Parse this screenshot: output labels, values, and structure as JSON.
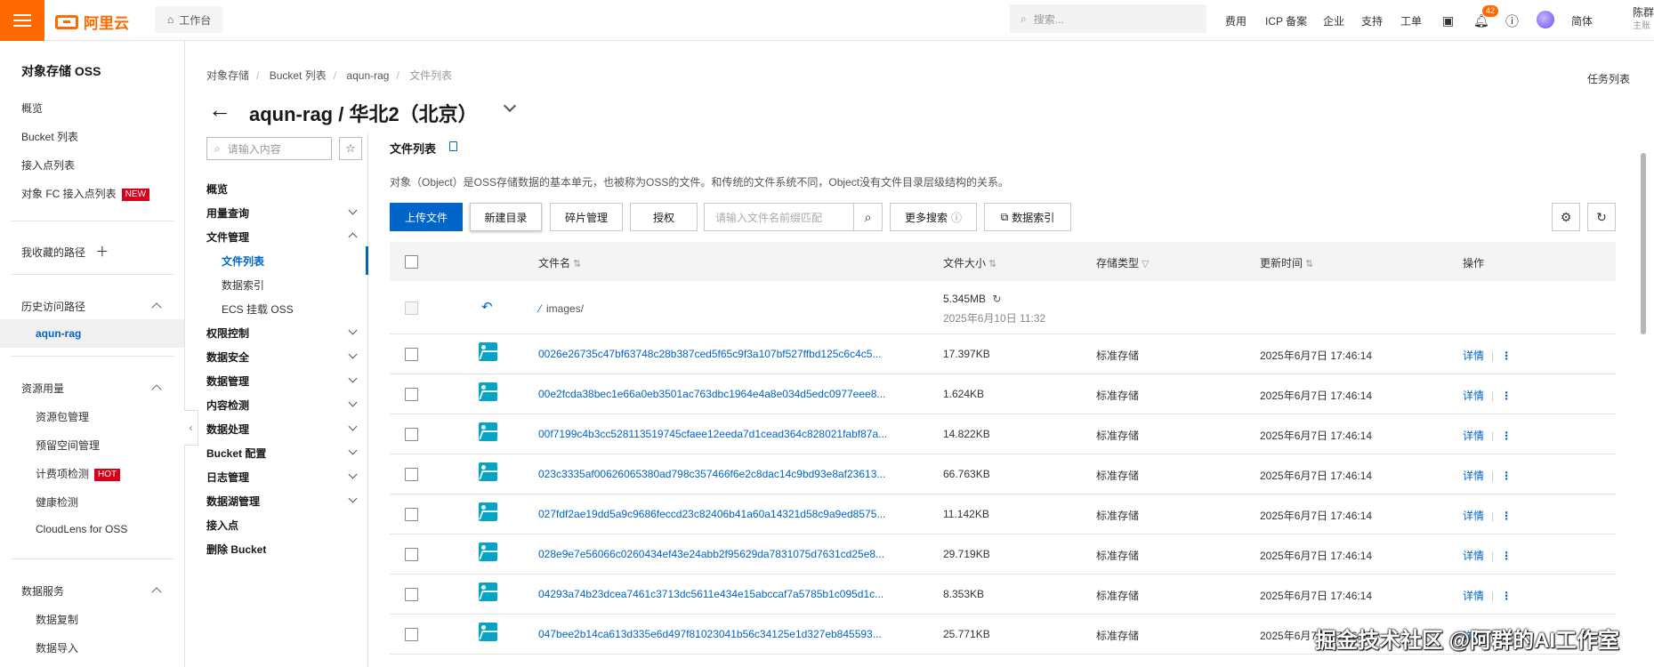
{
  "topbar": {
    "brand": "阿里云",
    "workbench": "工作台",
    "search_placeholder": "搜索...",
    "nav": [
      "费用",
      "ICP 备案",
      "企业",
      "支持",
      "工单"
    ],
    "bell_count": "42",
    "lang": "简体",
    "user_name": "陈群",
    "user_role": "主账"
  },
  "sidebar": {
    "title": "对象存储 OSS",
    "items": [
      "概览",
      "Bucket 列表",
      "接入点列表",
      "对象 FC 接入点列表"
    ],
    "new_badge": "NEW",
    "favorites": "我收藏的路径",
    "history": "历史访问路径",
    "history_active": "aqun-rag",
    "resources": "资源用量",
    "resource_items": [
      "资源包管理",
      "预留空间管理",
      "计费项检测",
      "健康检测",
      "CloudLens for OSS"
    ],
    "hot_badge": "HOT",
    "data_service": "数据服务",
    "data_items": [
      "数据复制",
      "数据导入"
    ]
  },
  "breadcrumb": [
    "对象存储",
    "Bucket 列表",
    "aqun-rag",
    "文件列表"
  ],
  "task_list": "任务列表",
  "page_title": "aqun-rag / 华北2（北京）",
  "subnav": {
    "search_placeholder": "请输入内容",
    "items": [
      {
        "label": "概览",
        "chev": ""
      },
      {
        "label": "用量查询",
        "chev": "down"
      },
      {
        "label": "文件管理",
        "chev": "up"
      },
      {
        "label": "权限控制",
        "chev": "down"
      },
      {
        "label": "数据安全",
        "chev": "down"
      },
      {
        "label": "数据管理",
        "chev": "down"
      },
      {
        "label": "内容检测",
        "chev": "down"
      },
      {
        "label": "数据处理",
        "chev": "down"
      },
      {
        "label": "Bucket 配置",
        "chev": "down"
      },
      {
        "label": "日志管理",
        "chev": "down"
      },
      {
        "label": "数据湖管理",
        "chev": "down"
      },
      {
        "label": "接入点",
        "chev": ""
      },
      {
        "label": "删除 Bucket",
        "chev": ""
      }
    ],
    "file_sub": [
      "文件列表",
      "数据索引",
      "ECS 挂载 OSS"
    ]
  },
  "content": {
    "title": "文件列表",
    "description": "对象（Object）是OSS存储数据的基本单元，也被称为OSS的文件。和传统的文件系统不同，Object没有文件目录层级结构的关系。",
    "buttons": {
      "upload": "上传文件",
      "new_dir": "新建目录",
      "fragments": "碎片管理",
      "authorize": "授权",
      "more_search": "更多搜索",
      "data_index": "数据索引"
    },
    "prefix_placeholder": "请输入文件名前缀匹配"
  },
  "table": {
    "headers": {
      "name": "文件名",
      "size": "文件大小",
      "storage": "存储类型",
      "updated": "更新时间",
      "actions": "操作"
    },
    "parent_row": {
      "name": "images/",
      "size": "5.345MB",
      "date": "2025年6月10日 11:32"
    },
    "rows": [
      {
        "name": "0026e26735c47bf63748c28b387ced5f65c9f3a107bf527ffbd125c6c4c5...",
        "size": "17.397KB",
        "storage": "标准存储",
        "updated": "2025年6月7日 17:46:14"
      },
      {
        "name": "00e2fcda38bec1e66a0eb3501ac763dbc1964e4a8e034d5edc0977eee8...",
        "size": "1.624KB",
        "storage": "标准存储",
        "updated": "2025年6月7日 17:46:14"
      },
      {
        "name": "00f7199c4b3cc528113519745cfaee12eeda7d1cead364c828021fabf87a...",
        "size": "14.822KB",
        "storage": "标准存储",
        "updated": "2025年6月7日 17:46:14"
      },
      {
        "name": "023c3335af00626065380ad798c357466f6e2c8dac14c9bd93e8af23613...",
        "size": "66.763KB",
        "storage": "标准存储",
        "updated": "2025年6月7日 17:46:14"
      },
      {
        "name": "027fdf2ae19dd5a9c9686feccd23c82406b41a60a14321d58c9a9ed8575...",
        "size": "11.142KB",
        "storage": "标准存储",
        "updated": "2025年6月7日 17:46:14"
      },
      {
        "name": "028e9e7e56066c0260434ef43e24abb2f95629da7831075d7631cd25e8...",
        "size": "29.719KB",
        "storage": "标准存储",
        "updated": "2025年6月7日 17:46:14"
      },
      {
        "name": "04293a74b23dcea7461c3713dc5611e434e15abccaf7a5785b1c095d1c...",
        "size": "8.353KB",
        "storage": "标准存储",
        "updated": "2025年6月7日 17:46:14"
      },
      {
        "name": "047bee2b14ca613d335e6d497f81023041b56c34125e1d327eb845593...",
        "size": "25.771KB",
        "storage": "标准存储",
        "updated": "2025年6月7日 17:46:14"
      }
    ],
    "detail_label": "详情"
  },
  "watermark": "掘金技术社区 @阿群的AI工作室"
}
